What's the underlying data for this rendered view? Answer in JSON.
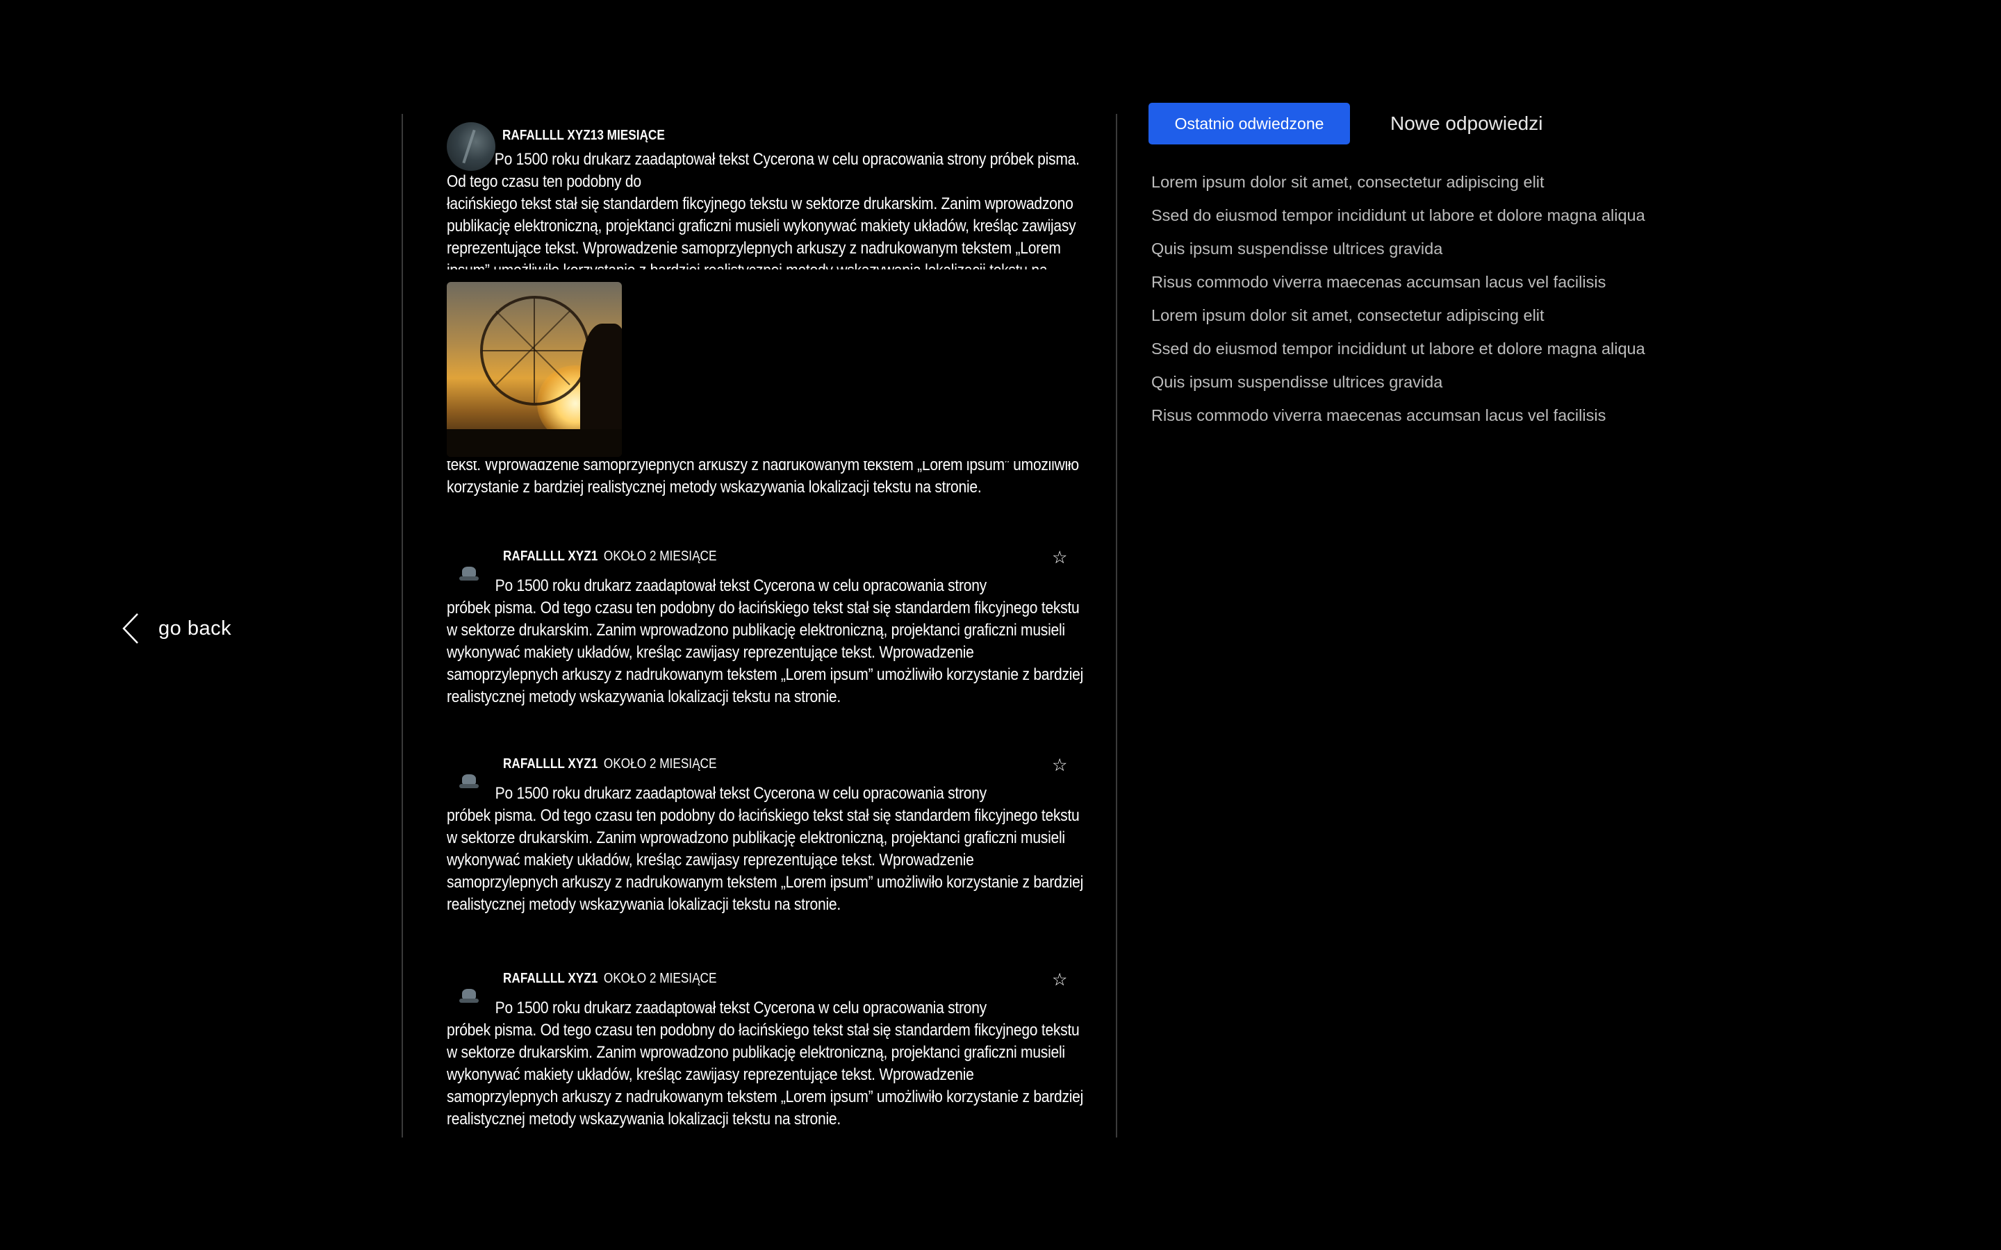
{
  "nav": {
    "go_back_label": "go back"
  },
  "first_post": {
    "author": "RAFALLLL XYZ13 MIESIĄCE",
    "text_line1": "Po 1500 roku drukarz zaadaptował tekst Cycerona w celu opracowania strony próbek pisma. Od tego czasu ten podobny do",
    "text_rest": "łacińskiego tekst stał się standardem fikcyjnego tekstu w sektorze drukarskim. Zanim wprowadzono publikację elektroniczną, projektanci graficzni musieli wykonywać makiety układów, kreśląc zawijasy reprezentujące tekst. Wprowadzenie samoprzylepnych arkuszy z nadrukowanym tekstem „Lorem ipsum” umożliwiło korzystanie z bardziej realistycznej metody wskazywania lokalizacji tekstu na stronie.",
    "image_icon": "ferris-wheel-sunset-photo"
  },
  "partial_post": {
    "text": "tekst. Wprowadzenie samoprzylepnych arkuszy z nadrukowanym tekstem „Lorem ipsum” umożliwiło korzystanie z bardziej realistycznej metody wskazywania lokalizacji tekstu na stronie."
  },
  "posts": [
    {
      "author": "RAFALLLL XYZ1",
      "time": "OKOŁO 2 MIESIĄCE",
      "star_icon": "☆",
      "text_first": "Po 1500 roku drukarz zaadaptował tekst Cycerona w celu opracowania strony",
      "text_rest": "próbek pisma. Od tego czasu ten podobny do łacińskiego tekst stał się standardem fikcyjnego tekstu w sektorze drukarskim. Zanim wprowadzono publikację elektroniczną, projektanci graficzni musieli wykonywać makiety układów, kreśląc zawijasy reprezentujące tekst. Wprowadzenie samoprzylepnych arkuszy z nadrukowanym tekstem „Lorem ipsum” umożliwiło korzystanie z bardziej realistycznej metody wskazywania lokalizacji tekstu na stronie."
    },
    {
      "author": "RAFALLLL XYZ1",
      "time": "OKOŁO 2 MIESIĄCE",
      "star_icon": "☆",
      "text_first": "Po 1500 roku drukarz zaadaptował tekst Cycerona w celu opracowania strony",
      "text_rest": "próbek pisma. Od tego czasu ten podobny do łacińskiego tekst stał się standardem fikcyjnego tekstu w sektorze drukarskim. Zanim wprowadzono publikację elektroniczną, projektanci graficzni musieli wykonywać makiety układów, kreśląc zawijasy reprezentujące tekst. Wprowadzenie samoprzylepnych arkuszy z nadrukowanym tekstem „Lorem ipsum” umożliwiło korzystanie z bardziej realistycznej metody wskazywania lokalizacji tekstu na stronie."
    },
    {
      "author": "RAFALLLL XYZ1",
      "time": "OKOŁO 2 MIESIĄCE",
      "star_icon": "☆",
      "text_first": "Po 1500 roku drukarz zaadaptował tekst Cycerona w celu opracowania strony",
      "text_rest": "próbek pisma. Od tego czasu ten podobny do łacińskiego tekst stał się standardem fikcyjnego tekstu w sektorze drukarskim. Zanim wprowadzono publikację elektroniczną, projektanci graficzni musieli wykonywać makiety układów, kreśląc zawijasy reprezentujące tekst. Wprowadzenie samoprzylepnych arkuszy z nadrukowanym tekstem „Lorem ipsum” umożliwiło korzystanie z bardziej realistycznej metody wskazywania lokalizacji tekstu na stronie."
    }
  ],
  "sidebar": {
    "tab_active": "Ostatnio odwiedzone",
    "tab_inactive": "Nowe odpowiedzi",
    "accent_color": "#1f5eea",
    "items": [
      "Lorem ipsum dolor sit amet, consectetur adipiscing elit",
      "Ssed do eiusmod tempor incididunt ut labore et dolore magna aliqua",
      "Quis ipsum suspendisse ultrices gravida",
      "Risus commodo viverra maecenas accumsan lacus vel facilisis",
      "Lorem ipsum dolor sit amet, consectetur adipiscing elit",
      "Ssed do eiusmod tempor incididunt ut labore et dolore magna aliqua",
      "Quis ipsum suspendisse ultrices gravida",
      "Risus commodo viverra maecenas accumsan lacus vel facilisis"
    ]
  }
}
